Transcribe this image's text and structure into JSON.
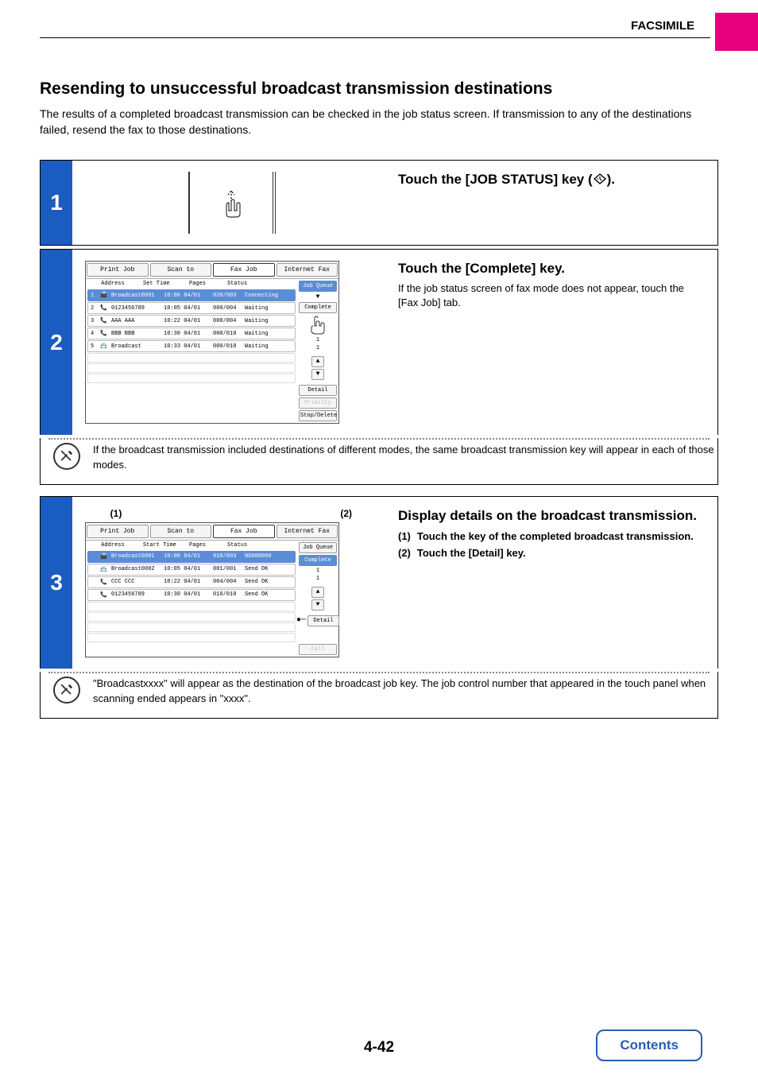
{
  "chapter": "FACSIMILE",
  "title": "Resending to unsuccessful broadcast transmission destinations",
  "intro": "The results of a completed broadcast transmission can be checked in the job status screen. If transmission to any of the destinations failed, resend the fax to those destinations.",
  "page_number": "4-42",
  "contents_label": "Contents",
  "step1": {
    "num": "1",
    "title_prefix": "Touch the [JOB STATUS] key (",
    "title_suffix": ")."
  },
  "step2": {
    "num": "2",
    "title": "Touch the [Complete] key.",
    "desc": "If the job status screen of fax mode does not appear, touch the [Fax Job] tab.",
    "note": "If the broadcast transmission included destinations of different modes, the same broadcast transmission key will appear in each of those modes.",
    "screen": {
      "tabs": [
        "Print Job",
        "Scan to",
        "Fax Job",
        "Internet Fax"
      ],
      "headers": [
        "Address",
        "Set Time",
        "Pages",
        "Status"
      ],
      "rows": [
        {
          "n": "1",
          "icon": "📠",
          "addr": "Broadcast0001",
          "time": "10:00 04/01",
          "pg": "020/003",
          "st": "Connecting",
          "sel": true
        },
        {
          "n": "2",
          "icon": "📞",
          "addr": "0123456789",
          "time": "10:05 04/01",
          "pg": "000/004",
          "st": "Waiting"
        },
        {
          "n": "3",
          "icon": "📞",
          "addr": "AAA AAA",
          "time": "10:22 04/01",
          "pg": "000/004",
          "st": "Waiting"
        },
        {
          "n": "4",
          "icon": "📞",
          "addr": "BBB BBB",
          "time": "10:30 04/01",
          "pg": "000/010",
          "st": "Waiting"
        },
        {
          "n": "5",
          "icon": "📇",
          "addr": "Broadcast",
          "time": "10:33 04/01",
          "pg": "000/010",
          "st": "Waiting"
        }
      ],
      "side": {
        "job_queue": "Job Queue",
        "complete": "Complete",
        "detail": "Detail",
        "priority": "Priority",
        "stop": "Stop/Delete",
        "count1": "1",
        "count2": "1"
      }
    }
  },
  "step3": {
    "num": "3",
    "title": "Display details on the broadcast transmission.",
    "callouts": {
      "c1": "(1)",
      "c2": "(2)"
    },
    "sub1_num": "(1)",
    "sub1_text": "Touch the key of the completed broadcast transmission.",
    "sub2_num": "(2)",
    "sub2_text": "Touch the [Detail] key.",
    "note": "\"Broadcastxxxx\" will appear as the destination of the broadcast job key. The job control number that appeared in the touch panel when scanning ended appears in \"xxxx\".",
    "screen": {
      "tabs": [
        "Print Job",
        "Scan to",
        "Fax Job",
        "Internet Fax"
      ],
      "headers": [
        "Address",
        "Start Time",
        "Pages",
        "Status"
      ],
      "rows": [
        {
          "n": "",
          "icon": "📠",
          "addr": "Broadcast0001",
          "time": "10:00 04/01",
          "pg": "010/003",
          "st": "NG000000",
          "sel": true
        },
        {
          "n": "",
          "icon": "📇",
          "addr": "Broadcast0002",
          "time": "10:05 04/01",
          "pg": "001/001",
          "st": "Send OK"
        },
        {
          "n": "",
          "icon": "📞",
          "addr": "CCC CCC",
          "time": "10:22 04/01",
          "pg": "004/004",
          "st": "Send OK"
        },
        {
          "n": "",
          "icon": "📞",
          "addr": "0123456789",
          "time": "10:30 04/01",
          "pg": "010/010",
          "st": "Send OK"
        }
      ],
      "side": {
        "job_queue": "Job Queue",
        "complete": "Complete",
        "detail": "Detail",
        "call": "Call",
        "count1": "1",
        "count2": "1"
      }
    }
  }
}
